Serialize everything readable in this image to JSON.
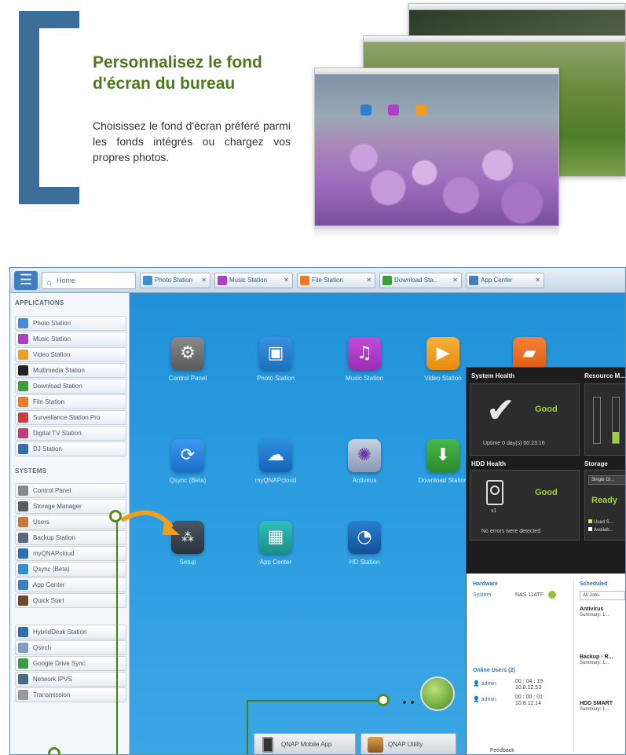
{
  "promo": {
    "title": "Personnalisez le fond d'écran du bureau",
    "body": "Choisissez le fond d'écran préféré parmi les fonds intégrés ou chargez vos propres photos."
  },
  "colors": {
    "accent_green": "#4a7a1e",
    "bracket_blue": "#3d6e9a",
    "desktop_blue": "#2a9be0"
  },
  "taskbar": {
    "menu_icon": "menu-icon",
    "home_label": "Home",
    "tabs": [
      {
        "label": "Photo Station",
        "color": "#3f8fd8"
      },
      {
        "label": "Music Station",
        "color": "#b03cc8"
      },
      {
        "label": "File Station",
        "color": "#f07a20"
      },
      {
        "label": "Download Sta...",
        "color": "#3aa03a"
      },
      {
        "label": "App Center",
        "color": "#3f7fc1"
      }
    ]
  },
  "sidebar": {
    "applications_header": "APPLICATIONS",
    "applications": [
      {
        "label": "Photo Station",
        "color": "#3f8fd8"
      },
      {
        "label": "Music Station",
        "color": "#b03cc8"
      },
      {
        "label": "Video Station",
        "color": "#f0a020"
      },
      {
        "label": "Multimedia Station",
        "color": "#222222"
      },
      {
        "label": "Download Station",
        "color": "#3aa03a"
      },
      {
        "label": "File Station",
        "color": "#f07a20"
      },
      {
        "label": "Surveillance Station Pro",
        "color": "#d03a3a"
      },
      {
        "label": "Digital TV Station",
        "color": "#c83a7a"
      },
      {
        "label": "DJ Station",
        "color": "#2f6db5"
      }
    ],
    "systems_header": "SYSTEMS",
    "systems": [
      {
        "label": "Control Panel",
        "color": "#8a8a8a"
      },
      {
        "label": "Storage Manager",
        "color": "#5a5a5a"
      },
      {
        "label": "Users",
        "color": "#c87a3a"
      },
      {
        "label": "Backup Station",
        "color": "#5a6a7a"
      },
      {
        "label": "myQNAPcloud",
        "color": "#2f6db5"
      },
      {
        "label": "Qsync (Beta)",
        "color": "#2f8fd8"
      },
      {
        "label": "App Center",
        "color": "#3f7fc1"
      },
      {
        "label": "Quick Start",
        "color": "#6a4a2a"
      }
    ],
    "extras": [
      {
        "label": "HybridDesk Station",
        "color": "#2f6db5"
      },
      {
        "label": "Qsirch",
        "color": "#7aa0c8"
      },
      {
        "label": "Google Drive Sync",
        "color": "#3a9a4a"
      },
      {
        "label": "Network IPVS",
        "color": "#4a6a8a"
      },
      {
        "label": "Transmission",
        "color": "#9a9a9a"
      }
    ]
  },
  "desktop": {
    "icons": [
      {
        "label": "Control Panel",
        "glyph": "⚙",
        "color": "#6e6e6e",
        "name": "control-panel-icon"
      },
      {
        "label": "Photo Station",
        "glyph": "▣",
        "color": "#2f7fd0",
        "name": "photo-station-icon"
      },
      {
        "label": "Music Station",
        "glyph": "♫",
        "color": "#b23ccb",
        "name": "music-station-icon"
      },
      {
        "label": "Video Station",
        "glyph": "▶",
        "color": "#f29a1e",
        "name": "video-station-icon"
      },
      {
        "label": "File Station",
        "glyph": "▰",
        "color": "#f06a1e",
        "name": "file-station-icon"
      },
      {
        "label": "Qsync (Beta)",
        "glyph": "⟳",
        "color": "#1e7fd8",
        "name": "qsync-icon"
      },
      {
        "label": "myQNAPcloud",
        "glyph": "☁",
        "color": "#1e73c8",
        "name": "myqnapcloud-icon"
      },
      {
        "label": "Antivirus",
        "glyph": "✺",
        "color": "#8a9ab8",
        "name": "antivirus-icon"
      },
      {
        "label": "Download Station",
        "glyph": "⬇",
        "color": "#3aa03a",
        "name": "download-station-icon"
      },
      {
        "label": "Setup",
        "glyph": "⁂",
        "color": "#3b4652",
        "name": "setup-icon"
      },
      {
        "label": "App Center",
        "glyph": "▦",
        "color": "#22a6a0",
        "name": "app-center-icon"
      },
      {
        "label": "HD Station",
        "glyph": "◔",
        "color": "#1f6fbf",
        "name": "hd-station-icon"
      }
    ]
  },
  "dashboard": {
    "system_health": "System Health",
    "resource_monitor": "Resource M...",
    "health_status": "Good",
    "uptime": "Uptime 0 day(s) 00:23:16",
    "hdd_health": "HDD Health",
    "hdd_status": "Good",
    "hdd_slot": "x1",
    "hdd_note": "No errors were detected",
    "storage": "Storage",
    "storage_volume": "Single Di...",
    "storage_status": "Ready",
    "storage_used": "Used S...",
    "storage_avail": "Availab...",
    "hardware": "Hardware",
    "system_label": "System",
    "system_model": "NAS 114TF",
    "scheduled": "Scheduled",
    "scheduled_filter": "All Jobs",
    "jobs": [
      {
        "title": "Antivirus",
        "summary": "Summary: 1..."
      },
      {
        "title": "Backup - R...",
        "summary": "Summary: 1..."
      },
      {
        "title": "HDD SMART",
        "summary": "Summary: 1..."
      }
    ],
    "online_users": "Online Users (2)",
    "users": [
      {
        "name": "admin",
        "time": "00 : 04 : 19",
        "ip": "10.8.12.53"
      },
      {
        "name": "admin",
        "time": "00 : 00 : 01",
        "ip": "10.8.12.14"
      }
    ],
    "feedback": "Feedback"
  },
  "bottom_tabs": [
    {
      "label": "QNAP Mobile App"
    },
    {
      "label": "QNAP Utility"
    }
  ]
}
